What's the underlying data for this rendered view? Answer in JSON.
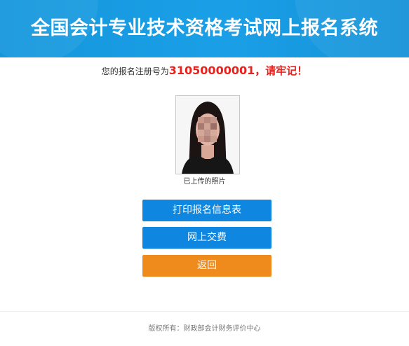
{
  "header": {
    "title": "全国会计专业技术资格考试网上报名系统",
    "bg_color": "#1a9fe6"
  },
  "registration": {
    "prefix": "您的报名注册号为",
    "number": "31050000001",
    "suffix": "，请牢记！",
    "highlight_color": "#e8211c"
  },
  "photo": {
    "caption": "已上传的照片"
  },
  "actions": {
    "print_label": "打印报名信息表",
    "pay_label": "网上交费",
    "back_label": "返回",
    "primary_color": "#0f86df",
    "secondary_color": "#ee8b1c"
  },
  "footer": {
    "copyright": "版权所有：财政部会计财务评价中心"
  }
}
